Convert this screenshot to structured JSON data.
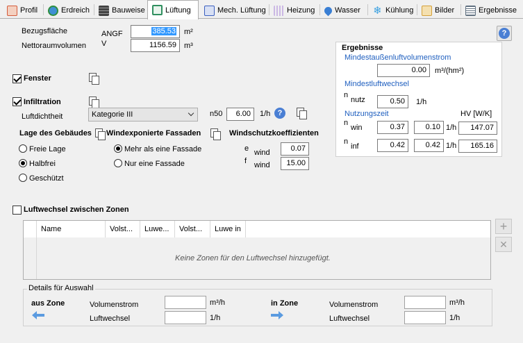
{
  "tabs": [
    {
      "label": "Profil",
      "icon": "profile-icon",
      "color": "#d45a3a"
    },
    {
      "label": "Erdreich",
      "icon": "globe-icon",
      "color": "#2f8f3f"
    },
    {
      "label": "Bauweise",
      "icon": "brick-wall-icon",
      "color": "#555555"
    },
    {
      "label": "Lüftung",
      "icon": "window-icon",
      "color": "#2f8f5f"
    },
    {
      "label": "Mech. Lüftung",
      "icon": "fan-unit-icon",
      "color": "#3a5fbf"
    },
    {
      "label": "Heizung",
      "icon": "radiator-icon",
      "color": "#b8a0d8"
    },
    {
      "label": "Wasser",
      "icon": "water-drop-icon",
      "color": "#3a7fd4"
    },
    {
      "label": "Kühlung",
      "icon": "snowflake-icon",
      "color": "#3aa0e0"
    },
    {
      "label": "Bilder",
      "icon": "image-icon",
      "color": "#d4a03a"
    },
    {
      "label": "Ergebnisse",
      "icon": "report-icon",
      "color": "#607080"
    }
  ],
  "active_tab": "Lüftung",
  "top": {
    "bezugsflaeche_label": "Bezugsfläche",
    "bezugsflaeche_symbol": "ANGF",
    "bezugsflaeche_value": "385.53",
    "bezugsflaeche_unit": "m²",
    "volumen_label": "Nettoraumvolumen",
    "volumen_symbol": "V",
    "volumen_value": "1156.59",
    "volumen_unit": "m³"
  },
  "help_icon": "?",
  "fenster": {
    "label": "Fenster",
    "checked": true
  },
  "infiltration": {
    "label": "Infiltration",
    "checked": true,
    "luftdichtheit_label": "Luftdichtheit",
    "luftdichtheit_selected": "Kategorie III",
    "n50_label": "n50",
    "n50_value": "6.00",
    "n50_unit": "1/h"
  },
  "lage": {
    "title": "Lage des Gebäudes",
    "options": [
      "Freie Lage",
      "Halbfrei",
      "Geschützt"
    ],
    "selected": "Halbfrei"
  },
  "fassaden": {
    "title": "Windexponierte Fassaden",
    "options": [
      "Mehr als eine Fassade",
      "Nur eine Fassade"
    ],
    "selected": "Mehr als eine Fassade"
  },
  "windschutz": {
    "title": "Windschutzkoeffizienten",
    "e_symbol": "e",
    "e_sub": "wind",
    "e_value": "0.07",
    "f_symbol": "f",
    "f_sub": "wind",
    "f_value": "15.00"
  },
  "ergebnisse": {
    "title": "Ergebnisse",
    "mindest_volumenstrom_label": "Mindestaußenluftvolumenstrom",
    "mindest_volumenstrom_value": "0.00",
    "mindest_volumenstrom_unit": "m³/(hm²)",
    "mindest_luftwechsel_label": "Mindestluftwechsel",
    "n_nutz_symbol": "n",
    "n_nutz_sub": "nutz",
    "n_nutz_value": "0.50",
    "n_nutz_unit": "1/h",
    "nutzungszeit_label": "Nutzungszeit",
    "hv_label": "HV [W/K]",
    "n_win_symbol": "n",
    "n_win_sub": "win",
    "n_win_value1": "0.37",
    "n_win_value2": "0.10",
    "n_win_unit": "1/h",
    "n_win_hv": "147.07",
    "n_inf_symbol": "n",
    "n_inf_sub": "inf",
    "n_inf_value1": "0.42",
    "n_inf_value2": "0.42",
    "n_inf_unit": "1/h",
    "n_inf_hv": "165.16"
  },
  "zonen": {
    "label": "Luftwechsel zwischen Zonen",
    "checked": false,
    "columns": [
      "Name",
      "Volst...",
      "Luwe...",
      "Volst...",
      "Luwe in"
    ],
    "empty_text": "Keine Zonen für den Luftwechsel hinzugefügt.",
    "add_icon": "+",
    "remove_icon": "✕"
  },
  "details": {
    "title": "Details für Auswahl",
    "aus_zone": "aus Zone",
    "in_zone": "in Zone",
    "volumenstrom_label": "Volumenstrom",
    "volumenstrom_unit": "m³/h",
    "luftwechsel_label": "Luftwechsel",
    "luftwechsel_unit": "1/h",
    "aus_volumenstrom_value": "",
    "aus_luftwechsel_value": "",
    "in_volumenstrom_value": "",
    "in_luftwechsel_value": ""
  }
}
